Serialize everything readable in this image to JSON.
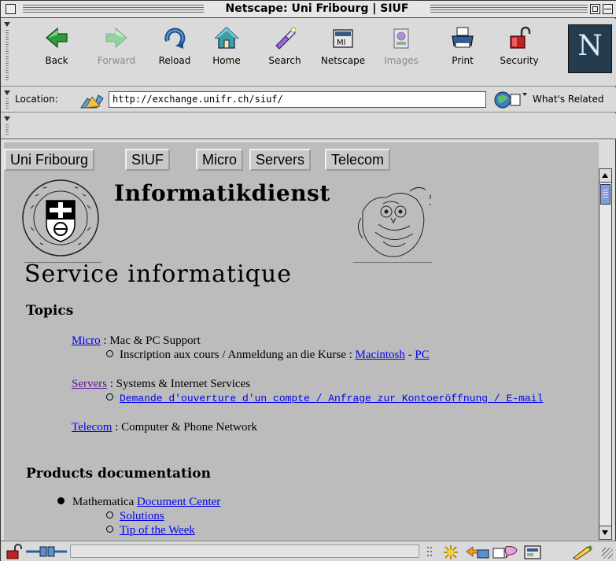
{
  "window": {
    "title": "Netscape: Uni Fribourg | SIUF"
  },
  "toolbar": {
    "back": "Back",
    "forward": "Forward",
    "reload": "Reload",
    "home": "Home",
    "search": "Search",
    "netscape": "Netscape",
    "images": "Images",
    "print": "Print",
    "security": "Security",
    "logo_letter": "N"
  },
  "location": {
    "label": "Location:",
    "url": "http://exchange.unifr.ch/siuf/",
    "related": "What's Related"
  },
  "nav": {
    "uni_fribourg": "Uni Fribourg",
    "siuf": "SIUF",
    "micro": "Micro",
    "servers": "Servers",
    "telecom": "Telecom"
  },
  "header": {
    "informatikdienst": "Informatikdienst",
    "page_title": "Service informatique"
  },
  "topics": {
    "heading": "Topics",
    "micro": {
      "link": "Micro",
      "desc": " : Mac & PC Support",
      "sub_text": "Inscription aux cours / Anmeldung an die Kurse : ",
      "macintosh": "Macintosh",
      "sep": " - ",
      "pc": "PC"
    },
    "servers": {
      "link": "Servers",
      "desc": " : Systems & Internet Services",
      "sub_link": "Demande d'ouverture d'un compte / Anfrage zur Kontoeröffnung / E-mail"
    },
    "telecom": {
      "link": "Telecom",
      "desc": " : Computer & Phone Network"
    }
  },
  "products": {
    "heading": "Products documentation",
    "mathematica": {
      "text": "Mathematica ",
      "link": "Document Center",
      "sub": [
        "Solutions",
        "Tip of the Week"
      ]
    }
  },
  "colors": {
    "link": "#0000ee",
    "visited_link": "#551a8b",
    "page_background": "#bcbcbc",
    "chrome": "#dadada"
  }
}
